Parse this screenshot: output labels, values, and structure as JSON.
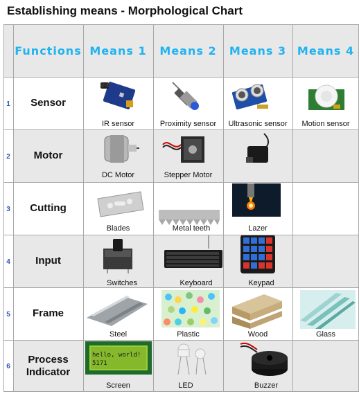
{
  "title": "Establishing means - Morphological Chart",
  "headers": [
    "Functions",
    "Means 1",
    "Means 2",
    "Means 3",
    "Means 4"
  ],
  "rows": [
    {
      "num": "1",
      "function": "Sensor",
      "means": [
        "IR sensor",
        "Proximity sensor",
        "Ultrasonic sensor",
        "Motion sensor"
      ]
    },
    {
      "num": "2",
      "function": "Motor",
      "means": [
        "DC Motor",
        "Stepper Motor",
        "",
        ""
      ]
    },
    {
      "num": "3",
      "function": "Cutting",
      "means": [
        "Blades",
        "Metal teeth",
        "Lazer",
        ""
      ]
    },
    {
      "num": "4",
      "function": "Input",
      "means": [
        "Switches",
        "Keyboard",
        "Keypad",
        ""
      ]
    },
    {
      "num": "5",
      "function": "Frame",
      "means": [
        "Steel",
        "Plastic",
        "Wood",
        "Glass"
      ]
    },
    {
      "num": "6",
      "function": "Process Indicator",
      "means": [
        "Screen",
        "LED",
        "Buzzer",
        ""
      ]
    }
  ],
  "screen_text": [
    "hello, world!",
    "5171"
  ],
  "icons": [
    "ir-sensor",
    "proximity-sensor",
    "ultrasonic-sensor",
    "motion-sensor",
    "dc-motor",
    "stepper-motor",
    "servo-motor",
    "razor-blade",
    "saw-teeth",
    "laser",
    "push-switch",
    "keyboard",
    "keypad",
    "steel-sheet",
    "plastic-pellets",
    "wood-planks",
    "glass-panes",
    "lcd-screen",
    "led",
    "buzzer"
  ],
  "colors": {
    "header_text": "#1fb3f0",
    "row_number": "#2a56b8",
    "shaded_row": "#e8e8e8",
    "grid_line": "#a8a8a8"
  }
}
